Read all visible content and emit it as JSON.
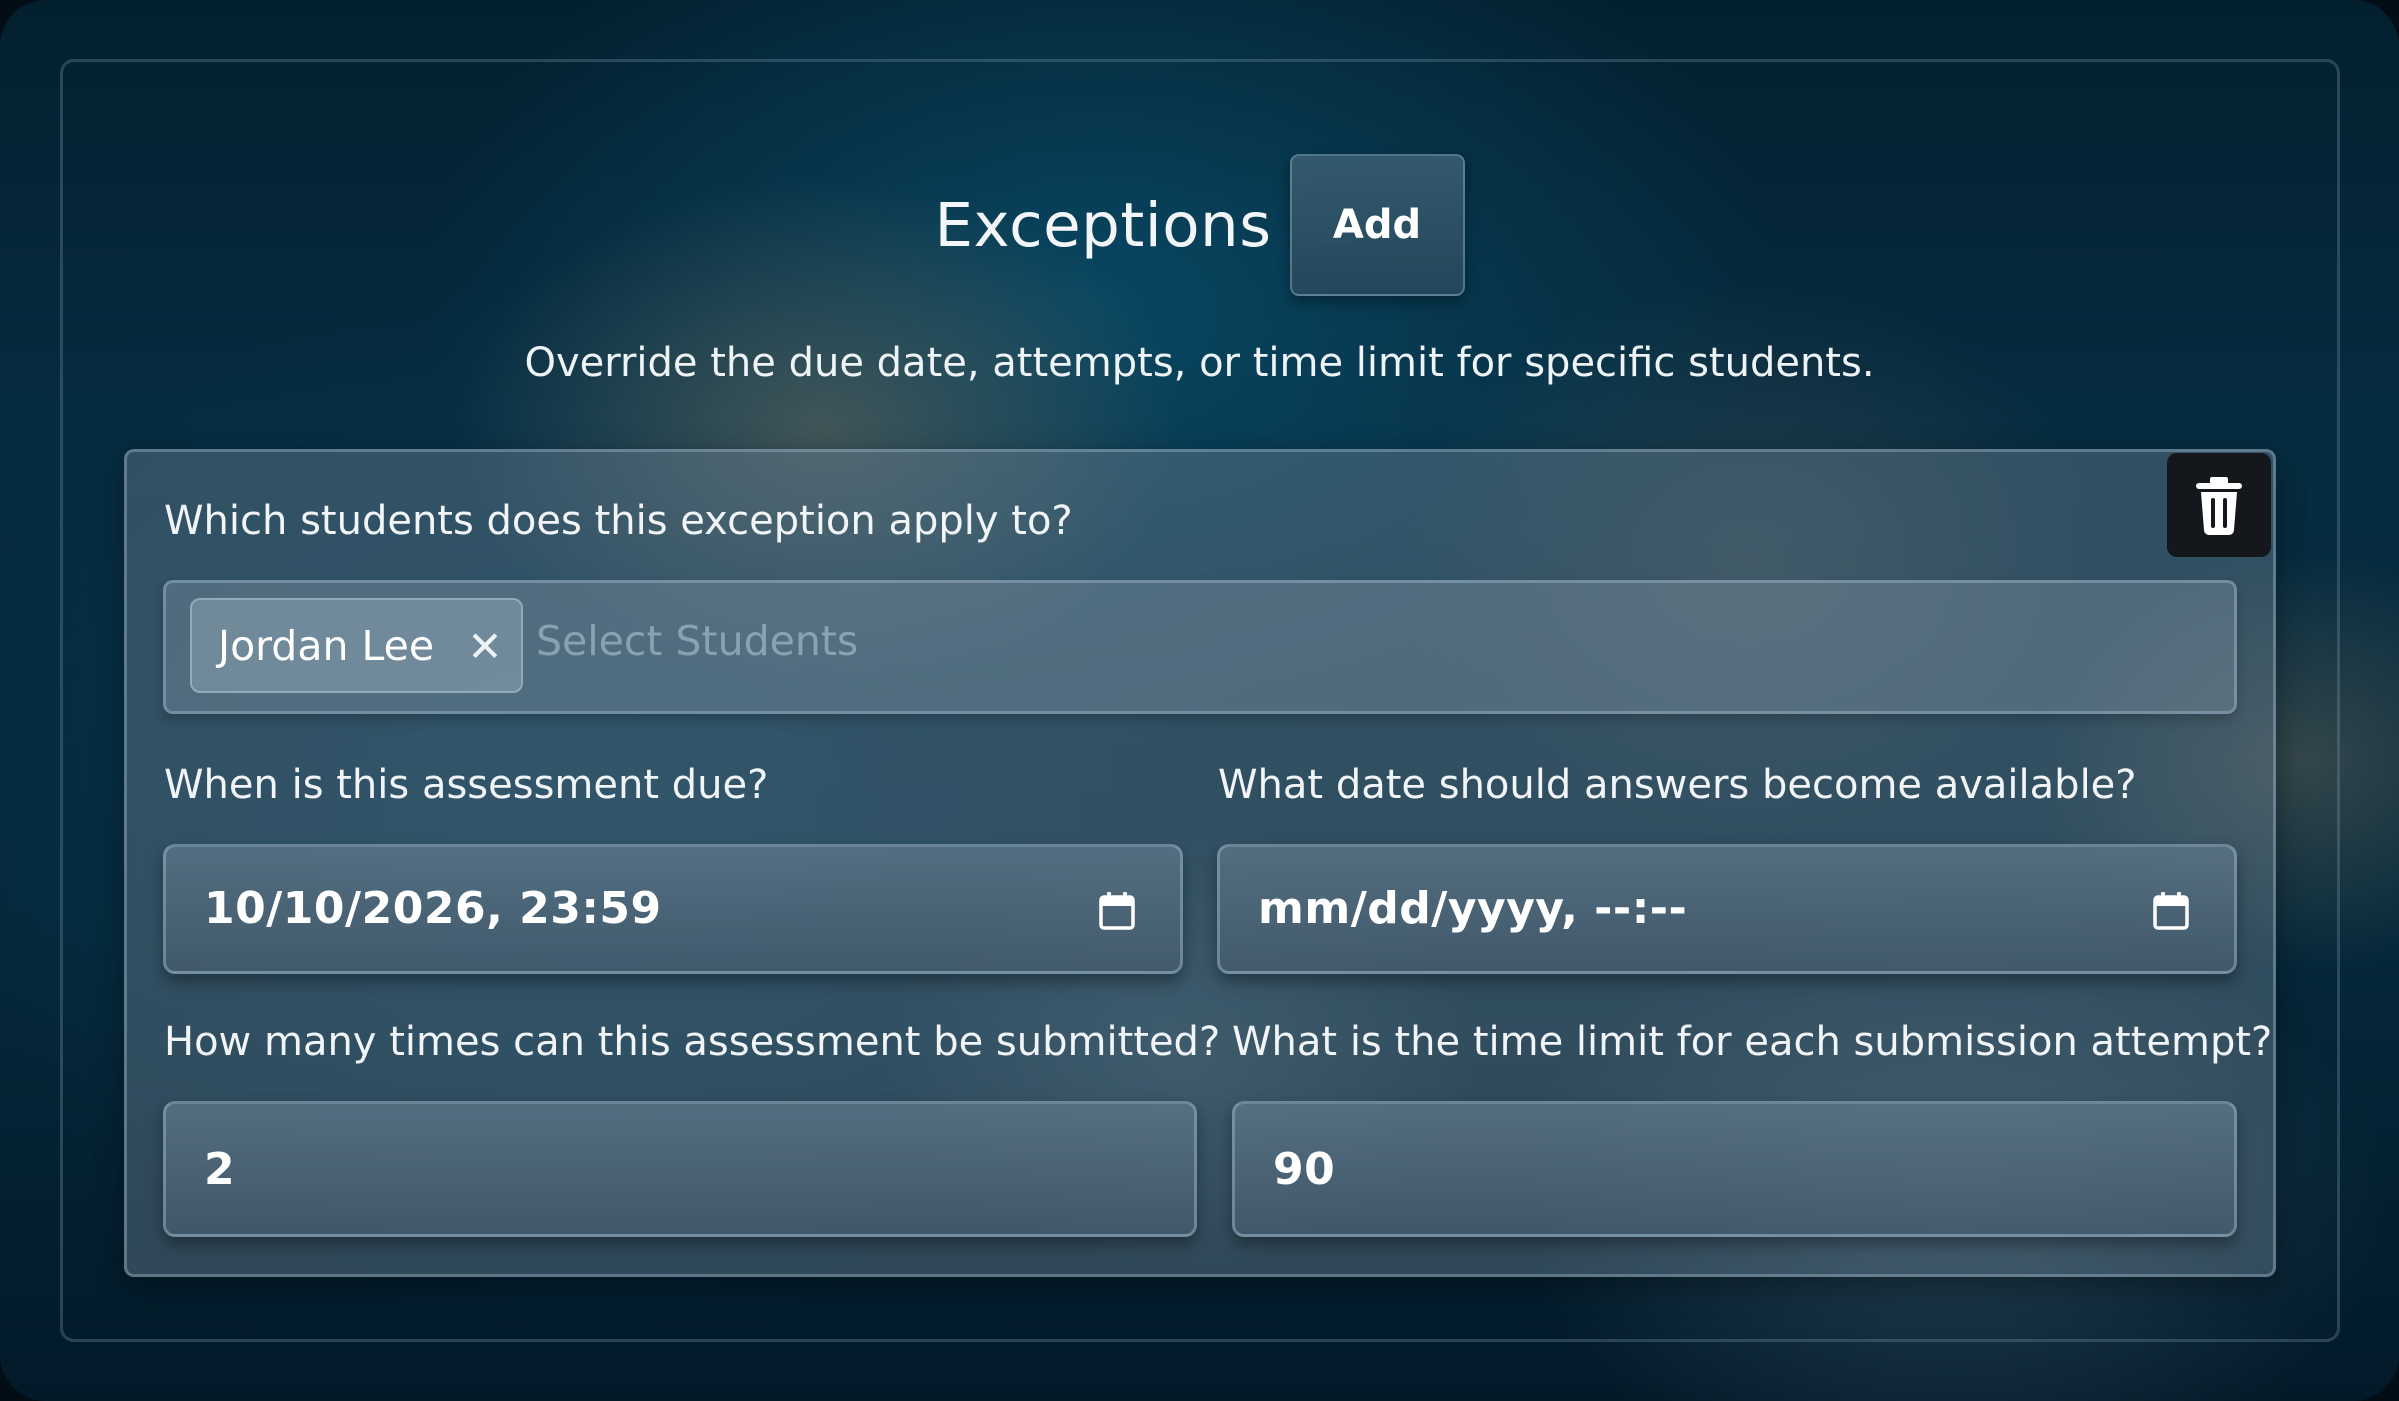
{
  "header": {
    "title": "Exceptions",
    "add_label": "Add",
    "subtitle": "Override the due date, attempts, or time limit for specific students."
  },
  "exception": {
    "students_label": "Which students does this exception apply to?",
    "selected_students": [
      "Jordan Lee"
    ],
    "students_placeholder": "Select Students",
    "due_label": "When is this assessment due?",
    "due_value": "10/10/2026, 23:59",
    "answers_label": "What date should answers become available?",
    "answers_value": "mm/dd/yyyy, --:--",
    "submissions_label": "How many times can this assessment be submitted?",
    "submissions_value": "2",
    "time_limit_label": "What is the time limit for each submission attempt?",
    "time_limit_value": "90"
  },
  "icons": {
    "delete": "trash-icon",
    "remove_chip": "close-icon",
    "date_picker": "calendar-icon"
  },
  "colors": {
    "delete_button_bg": "#14181c",
    "text": "#ffffff"
  }
}
